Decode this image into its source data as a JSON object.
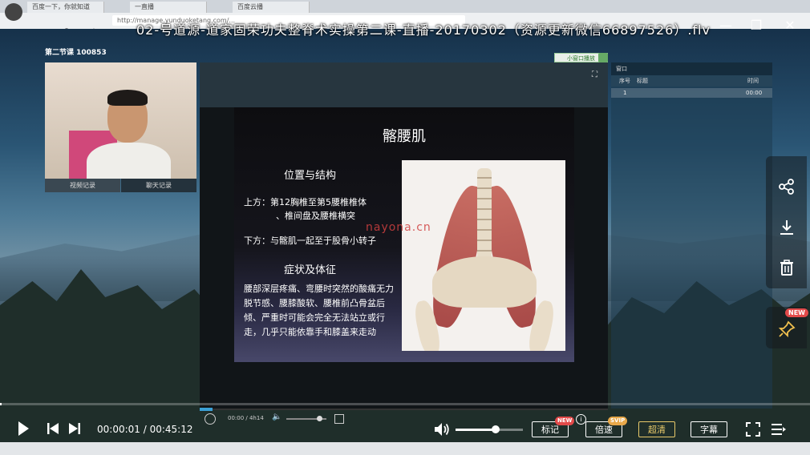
{
  "browser": {
    "tabs": [
      "百度一下，你就知道",
      "一直播",
      "百度云播"
    ],
    "url": "http://manage.yunduoketang.com/..."
  },
  "video": {
    "title": "02-号道源-道家固荣功夫整脊术实操第二课-直播-20170302（资源更新微信66897526）.flv"
  },
  "course": {
    "label": "第二节课 100853"
  },
  "cam_tabs": [
    "视频记录",
    "聊天记录"
  ],
  "small_window_label": "小窗口播放",
  "slide": {
    "title": "髂腰肌",
    "section1": "位置与结构",
    "line1": "上方：第12胸椎至第5腰椎椎体",
    "line2": "、椎间盘及腰椎横突",
    "line3": "下方：与髂肌一起至于股骨小转子",
    "section2": "症状及体征",
    "para": "腰部深层疼痛、弯腰时突然的酸痛无力脱节感、腰膝酸软、腰椎前凸骨盆后倾、严重时可能会完全无法站立或行走，几乎只能依靠手和膝盖来走动"
  },
  "watermark": "nayona.cn",
  "chat": {
    "header": "窗口",
    "col_num": "序号",
    "col_title": "标题",
    "col_time": "时间",
    "row_num": "1",
    "row_time": "00:00"
  },
  "inner_player": {
    "time": "00:00 / 4h14"
  },
  "player": {
    "current_time": "00:00:01",
    "separator": " / ",
    "total_time": "00:45:12",
    "volume_level": 0.6,
    "btn_mark": "标记",
    "btn_speed": "倍速",
    "btn_quality": "超清",
    "btn_subtitle": "字幕",
    "badge_new": "NEW",
    "badge_svip": "SVIP"
  },
  "sidebar_new_badge": "NEW",
  "colors": {
    "accent": "#3ba0d6",
    "quality": "#e8c96a",
    "badge_red": "#e24a4a"
  }
}
